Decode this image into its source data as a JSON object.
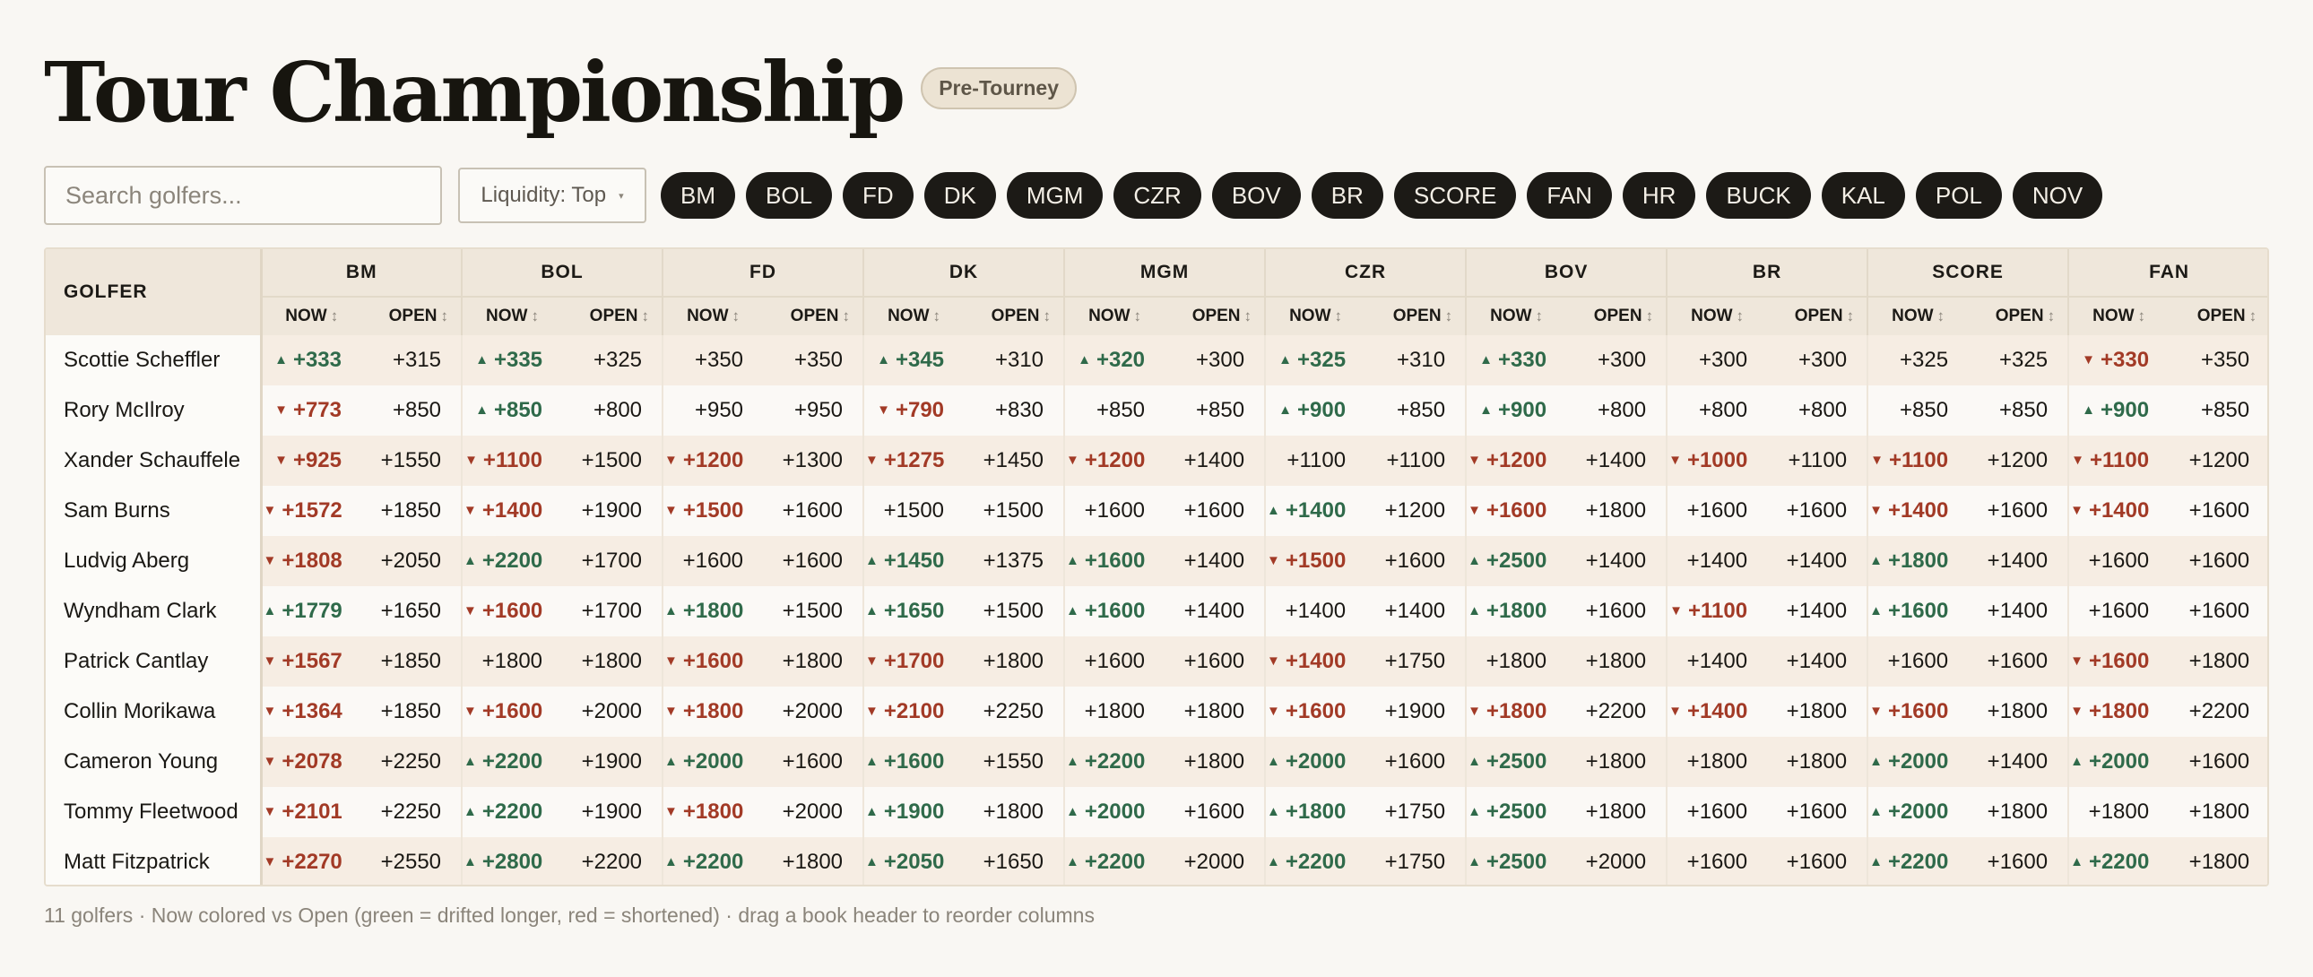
{
  "header": {
    "title": "Tour Championship",
    "badge": "Pre-Tourney"
  },
  "search": {
    "placeholder": "Search golfers..."
  },
  "liquidity": {
    "label": "Liquidity: Top",
    "caret": "▾"
  },
  "book_pills": [
    "BM",
    "BOL",
    "FD",
    "DK",
    "MGM",
    "CZR",
    "BOV",
    "BR",
    "SCORE",
    "FAN",
    "HR",
    "BUCK",
    "KAL",
    "POL",
    "NOV"
  ],
  "table": {
    "golfer_header": "GOLFER",
    "now_label": "NOW",
    "open_label": "OPEN",
    "sort_icon": "↕",
    "books": [
      "BM",
      "BOL",
      "FD",
      "DK",
      "MGM",
      "CZR",
      "BOV",
      "BR",
      "SCORE",
      "FAN"
    ],
    "rows": [
      {
        "name": "Scottie Scheffler",
        "cells": [
          {
            "now": "+333",
            "open": "+315",
            "dir": "up"
          },
          {
            "now": "+335",
            "open": "+325",
            "dir": "up"
          },
          {
            "now": "+350",
            "open": "+350",
            "dir": "flat"
          },
          {
            "now": "+345",
            "open": "+310",
            "dir": "up"
          },
          {
            "now": "+320",
            "open": "+300",
            "dir": "up"
          },
          {
            "now": "+325",
            "open": "+310",
            "dir": "up"
          },
          {
            "now": "+330",
            "open": "+300",
            "dir": "up"
          },
          {
            "now": "+300",
            "open": "+300",
            "dir": "flat"
          },
          {
            "now": "+325",
            "open": "+325",
            "dir": "flat"
          },
          {
            "now": "+330",
            "open": "+350",
            "dir": "down"
          }
        ]
      },
      {
        "name": "Rory McIlroy",
        "cells": [
          {
            "now": "+773",
            "open": "+850",
            "dir": "down"
          },
          {
            "now": "+850",
            "open": "+800",
            "dir": "up"
          },
          {
            "now": "+950",
            "open": "+950",
            "dir": "flat"
          },
          {
            "now": "+790",
            "open": "+830",
            "dir": "down"
          },
          {
            "now": "+850",
            "open": "+850",
            "dir": "flat"
          },
          {
            "now": "+900",
            "open": "+850",
            "dir": "up"
          },
          {
            "now": "+900",
            "open": "+800",
            "dir": "up"
          },
          {
            "now": "+800",
            "open": "+800",
            "dir": "flat"
          },
          {
            "now": "+850",
            "open": "+850",
            "dir": "flat"
          },
          {
            "now": "+900",
            "open": "+850",
            "dir": "up"
          }
        ]
      },
      {
        "name": "Xander Schauffele",
        "cells": [
          {
            "now": "+925",
            "open": "+1550",
            "dir": "down"
          },
          {
            "now": "+1100",
            "open": "+1500",
            "dir": "down"
          },
          {
            "now": "+1200",
            "open": "+1300",
            "dir": "down"
          },
          {
            "now": "+1275",
            "open": "+1450",
            "dir": "down"
          },
          {
            "now": "+1200",
            "open": "+1400",
            "dir": "down"
          },
          {
            "now": "+1100",
            "open": "+1100",
            "dir": "flat"
          },
          {
            "now": "+1200",
            "open": "+1400",
            "dir": "down"
          },
          {
            "now": "+1000",
            "open": "+1100",
            "dir": "down"
          },
          {
            "now": "+1100",
            "open": "+1200",
            "dir": "down"
          },
          {
            "now": "+1100",
            "open": "+1200",
            "dir": "down"
          }
        ]
      },
      {
        "name": "Sam Burns",
        "cells": [
          {
            "now": "+1572",
            "open": "+1850",
            "dir": "down"
          },
          {
            "now": "+1400",
            "open": "+1900",
            "dir": "down"
          },
          {
            "now": "+1500",
            "open": "+1600",
            "dir": "down"
          },
          {
            "now": "+1500",
            "open": "+1500",
            "dir": "flat"
          },
          {
            "now": "+1600",
            "open": "+1600",
            "dir": "flat"
          },
          {
            "now": "+1400",
            "open": "+1200",
            "dir": "up"
          },
          {
            "now": "+1600",
            "open": "+1800",
            "dir": "down"
          },
          {
            "now": "+1600",
            "open": "+1600",
            "dir": "flat"
          },
          {
            "now": "+1400",
            "open": "+1600",
            "dir": "down"
          },
          {
            "now": "+1400",
            "open": "+1600",
            "dir": "down"
          }
        ]
      },
      {
        "name": "Ludvig Aberg",
        "cells": [
          {
            "now": "+1808",
            "open": "+2050",
            "dir": "down"
          },
          {
            "now": "+2200",
            "open": "+1700",
            "dir": "up"
          },
          {
            "now": "+1600",
            "open": "+1600",
            "dir": "flat"
          },
          {
            "now": "+1450",
            "open": "+1375",
            "dir": "up"
          },
          {
            "now": "+1600",
            "open": "+1400",
            "dir": "up"
          },
          {
            "now": "+1500",
            "open": "+1600",
            "dir": "down"
          },
          {
            "now": "+2500",
            "open": "+1400",
            "dir": "up"
          },
          {
            "now": "+1400",
            "open": "+1400",
            "dir": "flat"
          },
          {
            "now": "+1800",
            "open": "+1400",
            "dir": "up"
          },
          {
            "now": "+1600",
            "open": "+1600",
            "dir": "flat"
          }
        ]
      },
      {
        "name": "Wyndham Clark",
        "cells": [
          {
            "now": "+1779",
            "open": "+1650",
            "dir": "up"
          },
          {
            "now": "+1600",
            "open": "+1700",
            "dir": "down"
          },
          {
            "now": "+1800",
            "open": "+1500",
            "dir": "up"
          },
          {
            "now": "+1650",
            "open": "+1500",
            "dir": "up"
          },
          {
            "now": "+1600",
            "open": "+1400",
            "dir": "up"
          },
          {
            "now": "+1400",
            "open": "+1400",
            "dir": "flat"
          },
          {
            "now": "+1800",
            "open": "+1600",
            "dir": "up"
          },
          {
            "now": "+1100",
            "open": "+1400",
            "dir": "down"
          },
          {
            "now": "+1600",
            "open": "+1400",
            "dir": "up"
          },
          {
            "now": "+1600",
            "open": "+1600",
            "dir": "flat"
          }
        ]
      },
      {
        "name": "Patrick Cantlay",
        "cells": [
          {
            "now": "+1567",
            "open": "+1850",
            "dir": "down"
          },
          {
            "now": "+1800",
            "open": "+1800",
            "dir": "flat"
          },
          {
            "now": "+1600",
            "open": "+1800",
            "dir": "down"
          },
          {
            "now": "+1700",
            "open": "+1800",
            "dir": "down"
          },
          {
            "now": "+1600",
            "open": "+1600",
            "dir": "flat"
          },
          {
            "now": "+1400",
            "open": "+1750",
            "dir": "down"
          },
          {
            "now": "+1800",
            "open": "+1800",
            "dir": "flat"
          },
          {
            "now": "+1400",
            "open": "+1400",
            "dir": "flat"
          },
          {
            "now": "+1600",
            "open": "+1600",
            "dir": "flat"
          },
          {
            "now": "+1600",
            "open": "+1800",
            "dir": "down"
          }
        ]
      },
      {
        "name": "Collin Morikawa",
        "cells": [
          {
            "now": "+1364",
            "open": "+1850",
            "dir": "down"
          },
          {
            "now": "+1600",
            "open": "+2000",
            "dir": "down"
          },
          {
            "now": "+1800",
            "open": "+2000",
            "dir": "down"
          },
          {
            "now": "+2100",
            "open": "+2250",
            "dir": "down"
          },
          {
            "now": "+1800",
            "open": "+1800",
            "dir": "flat"
          },
          {
            "now": "+1600",
            "open": "+1900",
            "dir": "down"
          },
          {
            "now": "+1800",
            "open": "+2200",
            "dir": "down"
          },
          {
            "now": "+1400",
            "open": "+1800",
            "dir": "down"
          },
          {
            "now": "+1600",
            "open": "+1800",
            "dir": "down"
          },
          {
            "now": "+1800",
            "open": "+2200",
            "dir": "down"
          }
        ]
      },
      {
        "name": "Cameron Young",
        "cells": [
          {
            "now": "+2078",
            "open": "+2250",
            "dir": "down"
          },
          {
            "now": "+2200",
            "open": "+1900",
            "dir": "up"
          },
          {
            "now": "+2000",
            "open": "+1600",
            "dir": "up"
          },
          {
            "now": "+1600",
            "open": "+1550",
            "dir": "up"
          },
          {
            "now": "+2200",
            "open": "+1800",
            "dir": "up"
          },
          {
            "now": "+2000",
            "open": "+1600",
            "dir": "up"
          },
          {
            "now": "+2500",
            "open": "+1800",
            "dir": "up"
          },
          {
            "now": "+1800",
            "open": "+1800",
            "dir": "flat"
          },
          {
            "now": "+2000",
            "open": "+1400",
            "dir": "up"
          },
          {
            "now": "+2000",
            "open": "+1600",
            "dir": "up"
          }
        ]
      },
      {
        "name": "Tommy Fleetwood",
        "cells": [
          {
            "now": "+2101",
            "open": "+2250",
            "dir": "down"
          },
          {
            "now": "+2200",
            "open": "+1900",
            "dir": "up"
          },
          {
            "now": "+1800",
            "open": "+2000",
            "dir": "down"
          },
          {
            "now": "+1900",
            "open": "+1800",
            "dir": "up"
          },
          {
            "now": "+2000",
            "open": "+1600",
            "dir": "up"
          },
          {
            "now": "+1800",
            "open": "+1750",
            "dir": "up"
          },
          {
            "now": "+2500",
            "open": "+1800",
            "dir": "up"
          },
          {
            "now": "+1600",
            "open": "+1600",
            "dir": "flat"
          },
          {
            "now": "+2000",
            "open": "+1800",
            "dir": "up"
          },
          {
            "now": "+1800",
            "open": "+1800",
            "dir": "flat"
          }
        ]
      },
      {
        "name": "Matt Fitzpatrick",
        "cells": [
          {
            "now": "+2270",
            "open": "+2550",
            "dir": "down"
          },
          {
            "now": "+2800",
            "open": "+2200",
            "dir": "up"
          },
          {
            "now": "+2200",
            "open": "+1800",
            "dir": "up"
          },
          {
            "now": "+2050",
            "open": "+1650",
            "dir": "up"
          },
          {
            "now": "+2200",
            "open": "+2000",
            "dir": "up"
          },
          {
            "now": "+2200",
            "open": "+1750",
            "dir": "up"
          },
          {
            "now": "+2500",
            "open": "+2000",
            "dir": "up"
          },
          {
            "now": "+1600",
            "open": "+1600",
            "dir": "flat"
          },
          {
            "now": "+2200",
            "open": "+1600",
            "dir": "up"
          },
          {
            "now": "+2200",
            "open": "+1800",
            "dir": "up"
          }
        ]
      }
    ]
  },
  "colors": {
    "up": "#2f6a4a",
    "down": "#a23a26",
    "pill_bg": "#1c1a16"
  },
  "arrows": {
    "up": "▲",
    "down": "▼"
  },
  "footer": {
    "text": "11 golfers · Now colored vs Open (green = drifted longer, red = shortened) · drag a book header to reorder columns"
  }
}
